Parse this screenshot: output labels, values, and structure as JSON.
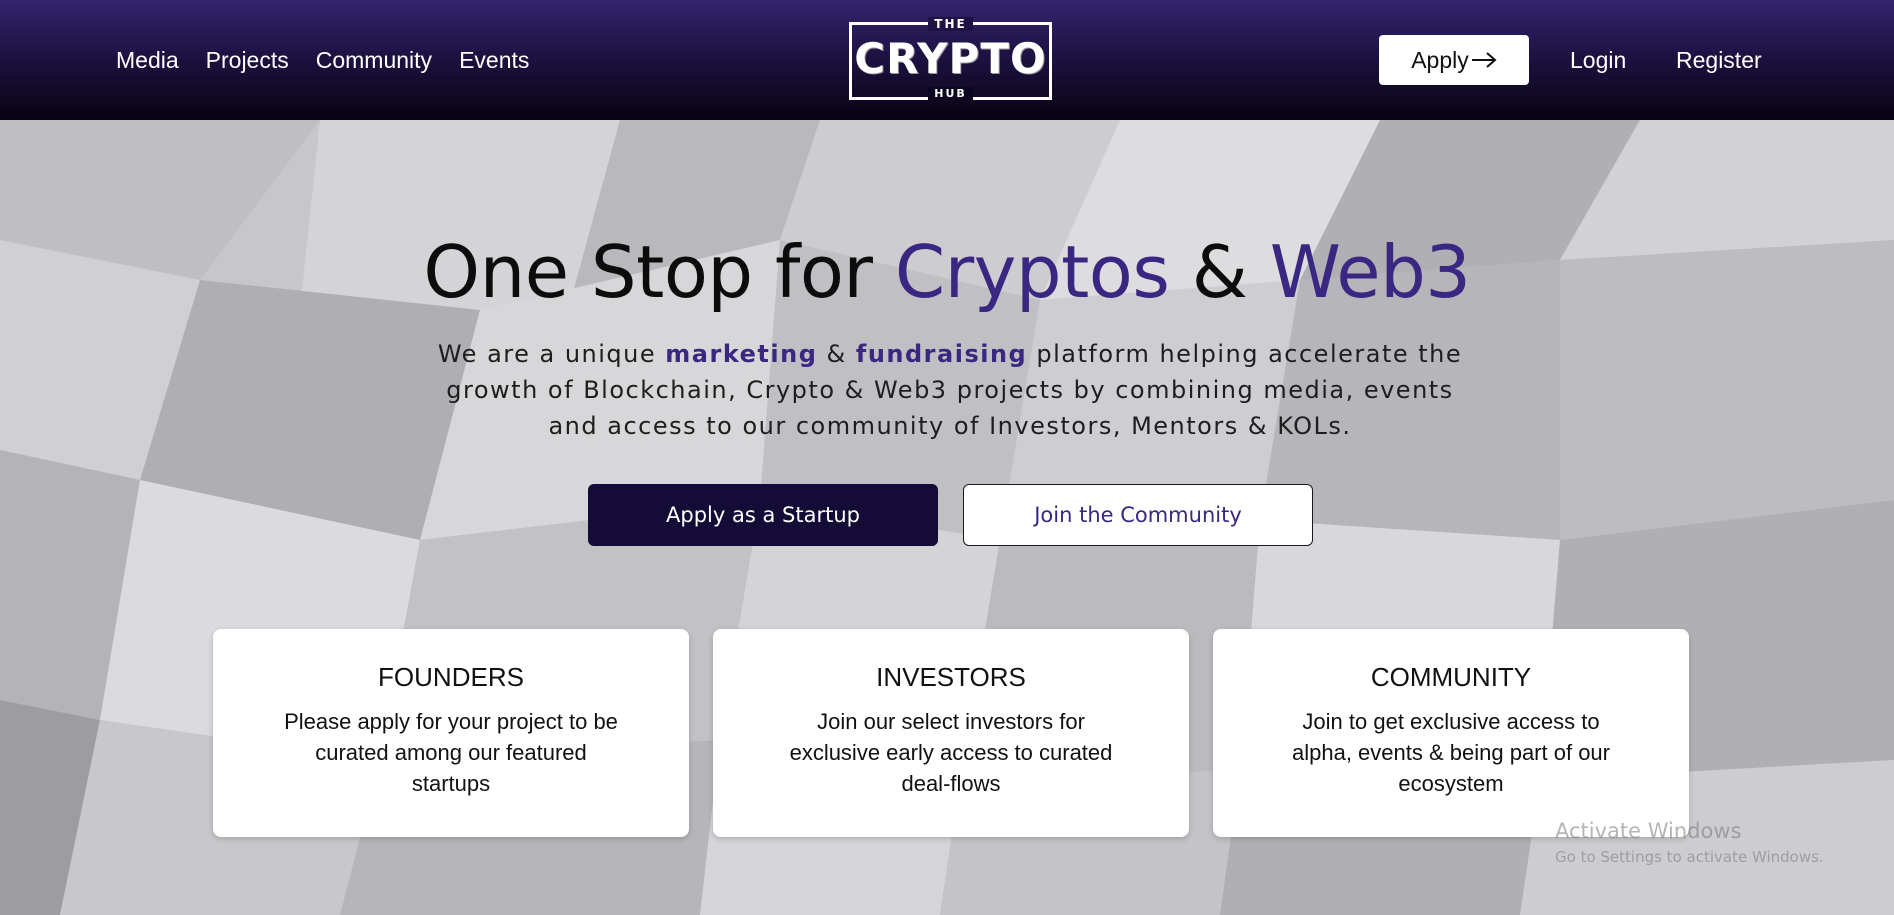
{
  "header": {
    "nav": [
      "Media",
      "Projects",
      "Community",
      "Events"
    ],
    "logo": {
      "top": "THE",
      "main": "CRYPTO",
      "bottom": "HUB"
    },
    "apply_label": "Apply",
    "apply_icon": "arrow-right-icon",
    "login_label": "Login",
    "register_label": "Register"
  },
  "hero": {
    "headline_part1": "One Stop for",
    "headline_accent1": "Cryptos",
    "headline_amp": "&",
    "headline_accent2": "Web3",
    "sub_part1": "We are a unique",
    "sub_hl1": "marketing",
    "sub_amp": "&",
    "sub_hl2": "fundraising",
    "sub_part2": "platform helping accelerate the growth of Blockchain, Crypto & Web3 projects by combining media, events and access to our community of Investors, Mentors & KOLs.",
    "primary_button": "Apply as a Startup",
    "secondary_button": "Join the Community"
  },
  "cards": [
    {
      "title": "FOUNDERS",
      "desc": "Please apply for your project to be curated among our featured startups"
    },
    {
      "title": "INVESTORS",
      "desc": "Join our select investors for exclusive early access to curated deal-flows"
    },
    {
      "title": "COMMUNITY",
      "desc": "Join to get exclusive access to alpha, events & being part of our ecosystem"
    }
  ],
  "watermark": {
    "line1": "Activate Windows",
    "line2": "Go to Settings to activate Windows."
  },
  "colors": {
    "accent": "#3a2782",
    "header_dark": "#090312",
    "primary_button": "#140c37"
  }
}
